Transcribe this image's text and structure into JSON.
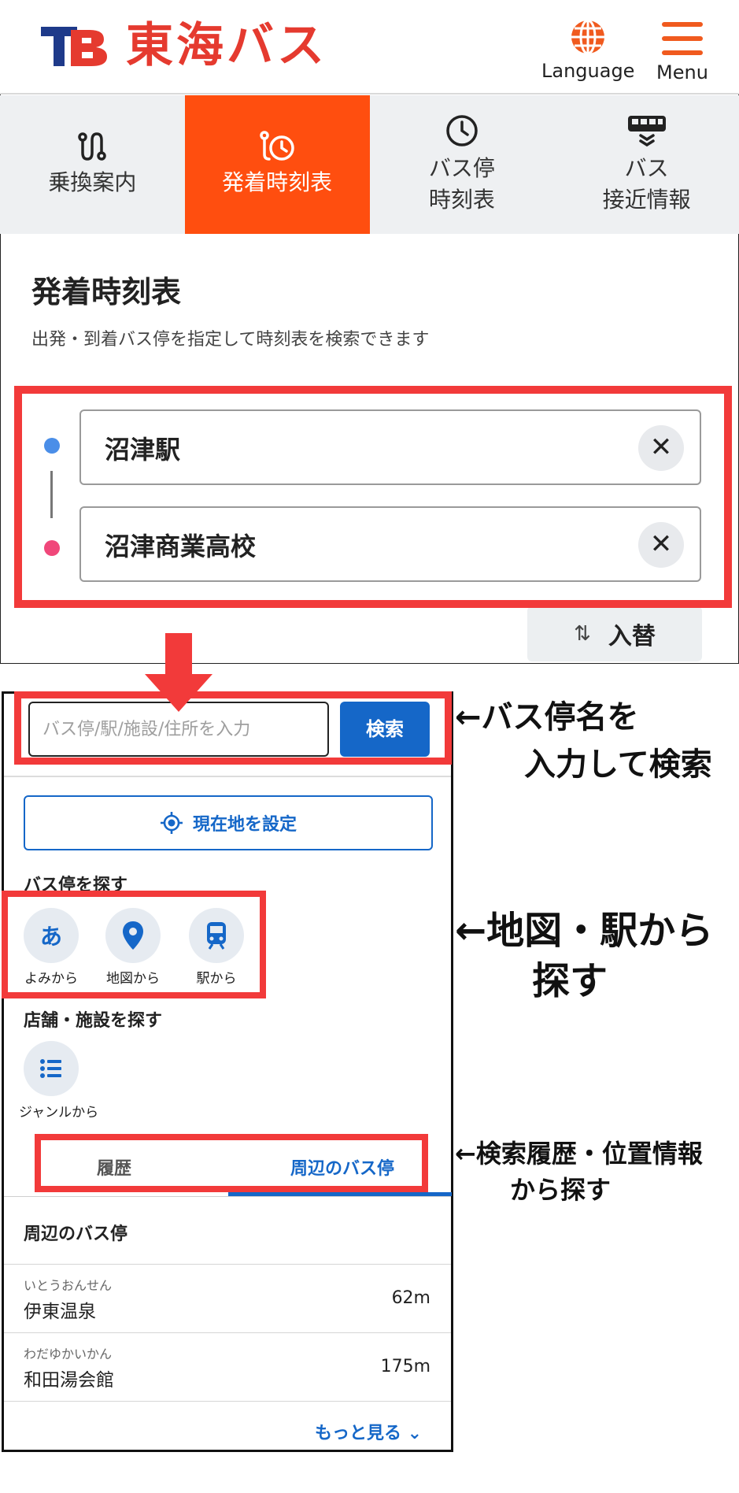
{
  "header": {
    "logo_mark": "TB",
    "logo_text": "東海バス",
    "language_label": "Language",
    "menu_label": "Menu"
  },
  "tabs": [
    {
      "label": "乗換案内",
      "icon": "route-icon",
      "active": false
    },
    {
      "label": "発着時刻表",
      "icon": "timetable-icon",
      "active": true
    },
    {
      "label": "バス停\n時刻表",
      "icon": "clock-icon",
      "active": false
    },
    {
      "label": "バス\n接近情報",
      "icon": "bus-approach-icon",
      "active": false
    }
  ],
  "page": {
    "title": "発着時刻表",
    "description": "出発・到着バス停を指定して時刻表を検索できます"
  },
  "route_form": {
    "from_value": "沼津駅",
    "to_value": "沼津商業高校",
    "clear_glyph": "✕",
    "swap_icon": "⇅",
    "swap_label": "入替"
  },
  "search": {
    "placeholder": "バス停/駅/施設/住所を入力",
    "button_label": "検索",
    "locate_label": "現在地を設定"
  },
  "busstop_finder": {
    "title": "バス停を探す",
    "buttons": [
      {
        "label": "よみから",
        "icon": "kana-icon",
        "glyph": "あ"
      },
      {
        "label": "地図から",
        "icon": "map-pin-icon"
      },
      {
        "label": "駅から",
        "icon": "train-icon"
      }
    ]
  },
  "shop_finder": {
    "title": "店舗・施設を探す",
    "buttons": [
      {
        "label": "ジャンルから",
        "icon": "list-icon"
      }
    ]
  },
  "history_tabs": {
    "history_label": "履歴",
    "nearby_label": "周辺のバス停",
    "active": "nearby"
  },
  "nearby": {
    "title": "周辺のバス停",
    "stops": [
      {
        "kana": "いとうおんせん",
        "name": "伊東温泉",
        "distance": "62m"
      },
      {
        "kana": "わだゆかいかん",
        "name": "和田湯会館",
        "distance": "175m"
      }
    ],
    "more_label": "もっと見る ⌄"
  },
  "annotations": {
    "search_line1": "←バス停名を",
    "search_line2": "入力して検索",
    "find_line1": "←地図・駅から",
    "find_line2": "探す",
    "history_line1": "←検索履歴・位置情報",
    "history_line2": "から探す"
  },
  "colors": {
    "brand_red": "#e53a2f",
    "active_tab": "#ff4e0f",
    "accent_blue": "#1567c8",
    "highlight_red": "#f23a3a",
    "from_dot": "#4a8ee8",
    "to_dot": "#f0477a"
  }
}
